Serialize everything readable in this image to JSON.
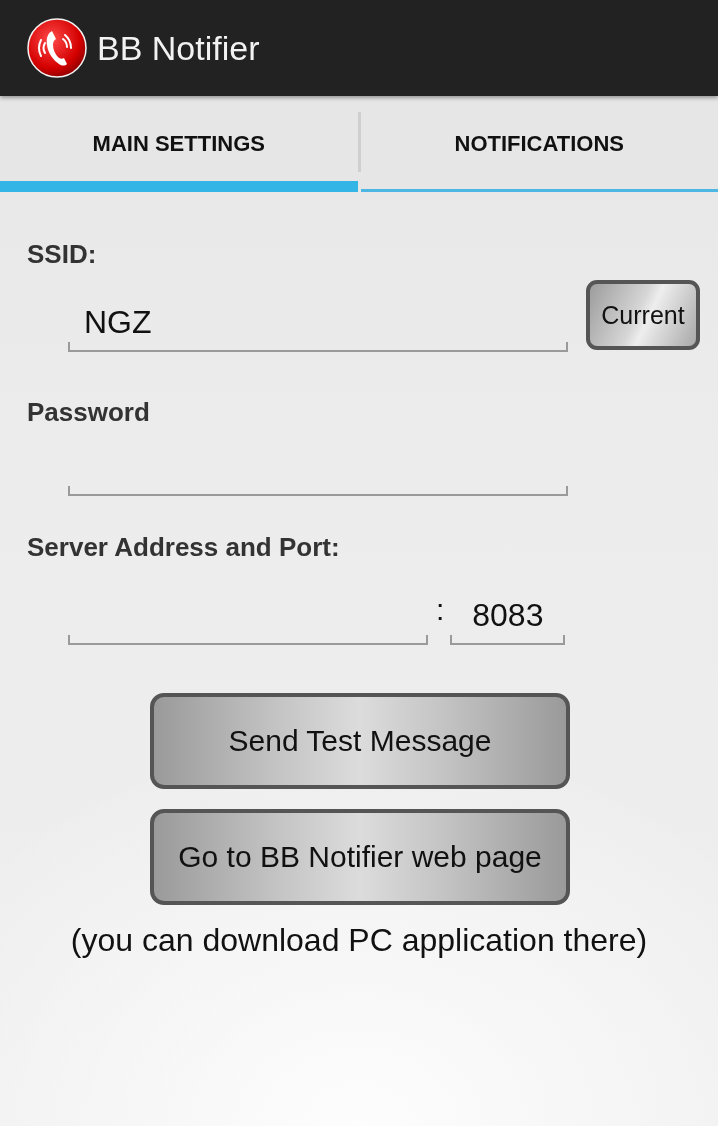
{
  "app_bar": {
    "title": "BB Notifier"
  },
  "tabs": [
    {
      "label": "MAIN SETTINGS",
      "selected": true
    },
    {
      "label": "NOTIFICATIONS",
      "selected": false
    }
  ],
  "form": {
    "ssid": {
      "label": "SSID:",
      "value": "NGZ",
      "button": "Current"
    },
    "password": {
      "label": "Password"
    },
    "server": {
      "label": "Server Address and Port:",
      "separator": ":",
      "port": "8083"
    }
  },
  "buttons": [
    "Send Test Message",
    "Go to BB Notifier web page"
  ],
  "note": "(you can download PC application there)"
}
